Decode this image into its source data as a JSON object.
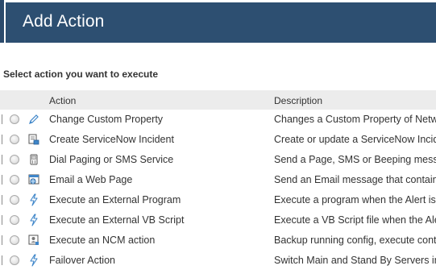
{
  "header": {
    "title": "Add Action"
  },
  "prompt": "Select action you want to execute",
  "table": {
    "columns": {
      "action": "Action",
      "description": "Description"
    },
    "rows": [
      {
        "icon": "pencil-icon",
        "action": "Change Custom Property",
        "description": "Changes a Custom Property of Netw"
      },
      {
        "icon": "servicenow-ticket-icon",
        "action": "Create ServiceNow Incident",
        "description": "Create or update a ServiceNow Incid"
      },
      {
        "icon": "pager-icon",
        "action": "Dial Paging or SMS Service",
        "description": "Send a Page, SMS or Beeping messa"
      },
      {
        "icon": "email-web-page-icon",
        "action": "Email a Web Page",
        "description": "Send an Email message that contain"
      },
      {
        "icon": "lightning-icon",
        "action": "Execute an External Program",
        "description": "Execute a program when the Alert is"
      },
      {
        "icon": "lightning-icon",
        "action": "Execute an External VB Script",
        "description": "Execute a VB Script file when the Ale"
      },
      {
        "icon": "ncm-device-icon",
        "action": "Execute an NCM action",
        "description": "Backup running config, execute cont"
      },
      {
        "icon": "lightning-icon",
        "action": "Failover Action",
        "description": "Switch Main and Stand By Servers in"
      }
    ]
  }
}
